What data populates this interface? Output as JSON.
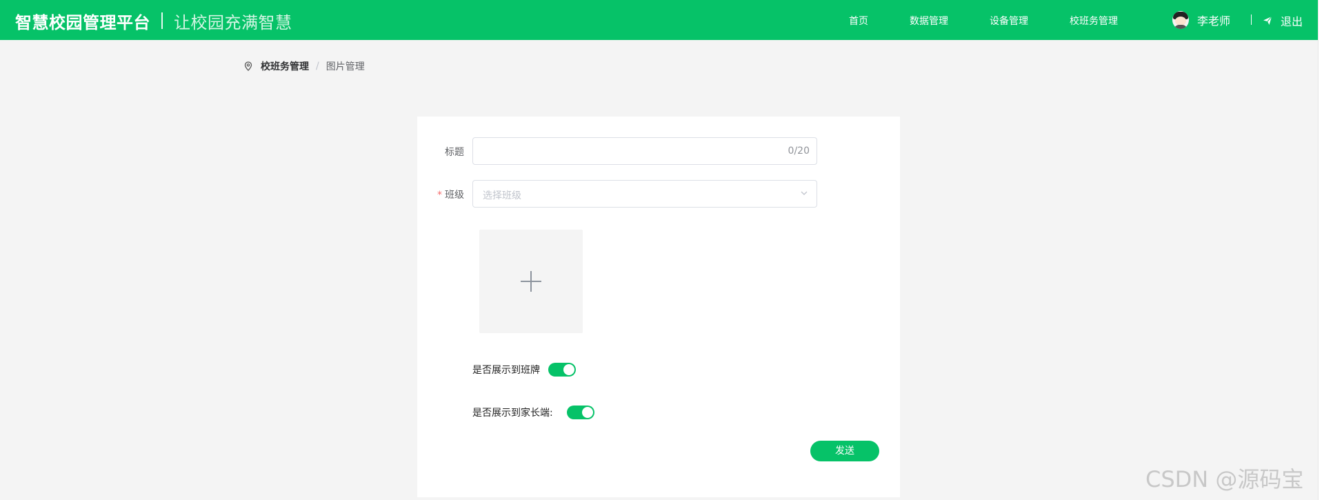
{
  "header": {
    "brand_title": "智慧校园管理平台",
    "slogan": "让校园充满智慧",
    "nav": [
      {
        "label": "首页"
      },
      {
        "label": "数据管理"
      },
      {
        "label": "设备管理"
      },
      {
        "label": "校班务管理"
      }
    ],
    "user_name": "李老师",
    "logout_label": "退出",
    "accent_color": "#06c268"
  },
  "breadcrumb": {
    "root": "校班务管理",
    "separator": "/",
    "current": "图片管理"
  },
  "form": {
    "title_label": "标题",
    "title_value": "",
    "title_count": "0/20",
    "class_required_mark": "*",
    "class_label": "班级",
    "class_placeholder": "选择班级",
    "show_on_board_label": "是否展示到班牌",
    "show_on_board": true,
    "show_to_parents_label": "是否展示到家长端:",
    "show_to_parents": true,
    "send_label": "发送"
  },
  "watermark": "CSDN @源码宝"
}
